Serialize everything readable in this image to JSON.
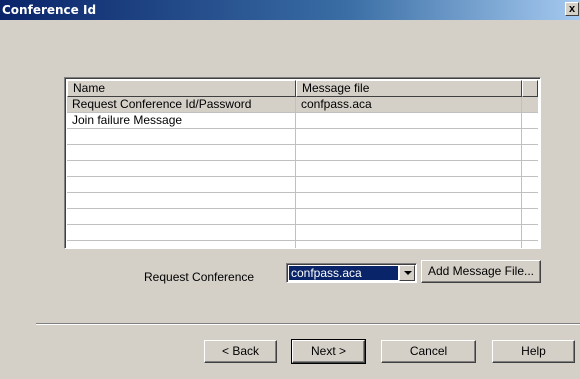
{
  "window": {
    "title": "Conference Id",
    "close_label": "x"
  },
  "list": {
    "columns": [
      "Name",
      "Message file"
    ],
    "rows": [
      {
        "name": "Request Conference Id/Password",
        "file": "confpass.aca",
        "selected": true
      },
      {
        "name": "Join failure Message",
        "file": "",
        "selected": false
      }
    ],
    "empty_rows": 8
  },
  "request_conference": {
    "label": "Request Conference",
    "selected_value": "confpass.aca"
  },
  "buttons": {
    "add_message_file": "Add Message File...",
    "back": "< Back",
    "next": "Next >",
    "cancel": "Cancel",
    "help": "Help"
  },
  "colors": {
    "title_bar": "#0a246a",
    "face": "#d4d0c8",
    "selection": "#0a246a"
  }
}
